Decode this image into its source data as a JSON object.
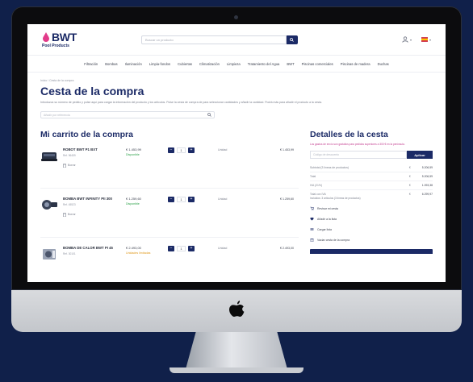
{
  "header": {
    "logo_text": "BWT",
    "logo_subtitle": "Pool Products",
    "search_placeholder": "Buscar un producto"
  },
  "nav": [
    "Filtración",
    "Bombas",
    "Iluminación",
    "Limpia-fondos",
    "Cubiertas",
    "Climatización",
    "Limpieza",
    "Tratamiento del Agua",
    "BWT",
    "Piscinas comerciales",
    "Piscinas de madera",
    "Duchas"
  ],
  "breadcrumb": "Inicio / Cesta de la compra",
  "page": {
    "title": "Cesta de la compra",
    "intro": "Introduzca su número de pedido y pulse aquí para cargar la información del producto y los artículos. Pulse la cesta de compra de para seleccionar cantidades y añadir la cantidad. Podrá más para añadir el producto a la cesta.",
    "add_placeholder": "Añadir por referencia"
  },
  "cart": {
    "title": "Mi carrito de la compra",
    "remove_label": "Borrar",
    "items": [
      {
        "name": "ROBOT BWT P1 BXT",
        "ref": "Ref. 96459",
        "price": "€ 1.453,99",
        "stock": "Disponible",
        "stock_status": "ok",
        "qty": "1",
        "unit": "Unidad",
        "total": "€ 1.453,99"
      },
      {
        "name": "BOMBA BWT INFINITY PII 300",
        "ref": "Ref. 45523",
        "price": "€ 1.259,60",
        "stock": "Disponible",
        "stock_status": "ok",
        "qty": "1",
        "unit": "Unidad",
        "total": "€ 1.259,60"
      },
      {
        "name": "BOMBA DE CALOR BWT PI 45",
        "ref": "Ref. 30101",
        "price": "€ 2.493,00",
        "stock": "Unidades limitadas",
        "stock_status": "warn",
        "qty": "1",
        "unit": "Unidad",
        "total": "€ 2.493,00"
      }
    ]
  },
  "summary": {
    "title": "Detalles de la cesta",
    "note": "Los gastos de envío son gratuitos para pedidos superiores a 300 € en la península.",
    "coupon_placeholder": "Código de descuento",
    "apply_label": "Aplicar",
    "currency": "€",
    "rows": [
      {
        "label": "Subtotal (3 líneas de productos)",
        "amount": "5.206,59"
      },
      {
        "label": "Total",
        "amount": "5.206,59"
      },
      {
        "label": "IVA (21%)",
        "amount": "1.093,38"
      },
      {
        "label": "Total con IVA",
        "amount": "6.299,97"
      }
    ],
    "vat_note": "Incluidos: 3 artículos (3 líneas de productos)",
    "actions": [
      "Revisar mi cesta",
      "Añadir a la lista",
      "Cargar lista",
      "Vaciar cesta de la compra"
    ]
  },
  "colors": {
    "brand": "#1b2a66",
    "background": "#10204a",
    "in_stock": "#2ea24a",
    "limited": "#e09a1e",
    "accent_pink": "#c23b8e"
  }
}
